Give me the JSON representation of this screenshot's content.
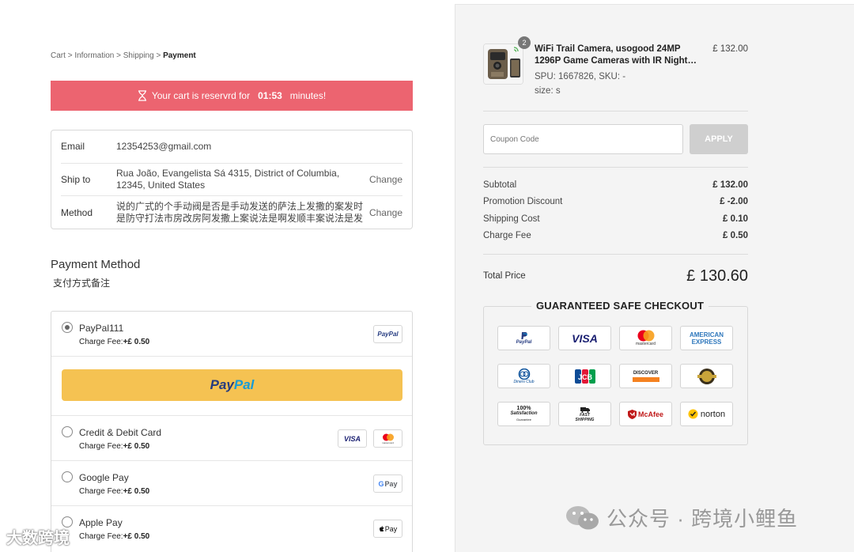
{
  "breadcrumb": {
    "items": [
      "Cart",
      "Information",
      "Shipping"
    ],
    "current": "Payment",
    "sep": ">"
  },
  "timer": {
    "prefix": "Your cart is reservrd for",
    "time": "01:53",
    "suffix": "minutes!"
  },
  "info": {
    "email_label": "Email",
    "email": "12354253@gmail.com",
    "ship_label": "Ship to",
    "ship": "Rua João, Evangelista Sá 4315, District of Columbia, 12345, United States",
    "method_label": "Method",
    "method": "说的广式的个手动阀是否是手动发送的萨法上发撒的案发时是防守打法市房改房阿发撒上案说法是啊发顺丰案说法是发啊说的",
    "change": "Change"
  },
  "payment": {
    "title": "Payment Method",
    "note": "支付方式备注",
    "options": [
      {
        "name": "PayPal111",
        "fee_label": "Charge Fee:",
        "fee": "+£ 0.50",
        "selected": true
      },
      {
        "name": "Credit & Debit Card",
        "fee_label": "Charge Fee:",
        "fee": "+£ 0.50",
        "selected": false
      },
      {
        "name": "Google Pay",
        "fee_label": "Charge Fee:",
        "fee": "+£ 0.50",
        "selected": false
      },
      {
        "name": "Apple Pay",
        "fee_label": "Charge Fee:",
        "fee": "+£ 0.50",
        "selected": false
      }
    ],
    "paypal_button": {
      "pay": "Pay",
      "pal": "Pal"
    },
    "logos": {
      "paypal": "PayPal",
      "visa": "VISA",
      "mastercard": "mastercard",
      "gpay": "Pay",
      "applepay": "Pay"
    }
  },
  "product": {
    "qty": "2",
    "title": "WiFi Trail Camera, usogood 24MP 1296P Game Cameras with IR Night…",
    "price": "£ 132.00",
    "sku": "SPU: 1667826, SKU: -",
    "size": "size: s"
  },
  "coupon": {
    "placeholder": "Coupon Code",
    "apply": "APPLY"
  },
  "summary": {
    "rows": [
      {
        "label": "Subtotal",
        "value": "£ 132.00"
      },
      {
        "label": "Promotion Discount",
        "value": "£ -2.00"
      },
      {
        "label": "Shipping Cost",
        "value": "£ 0.10"
      },
      {
        "label": "Charge Fee",
        "value": "£ 0.50"
      }
    ],
    "total_label": "Total Price",
    "total": "£ 130.60"
  },
  "checkout": {
    "title": "GUARANTEED SAFE CHECKOUT",
    "badges": {
      "paypal": "PayPal",
      "visa": "VISA",
      "mastercard": "mastercard",
      "amex1": "AMERICAN",
      "amex2": "EXPRESS",
      "diners": "Diners Club",
      "jcb": "JCB",
      "discover": "DISCOVER",
      "satisfaction1": "100%",
      "satisfaction2": "Satisfaction",
      "satisfaction3": "Guarantee",
      "fast1": "FAST",
      "fast2": "SHIPPING",
      "mcafee": "McAfee",
      "norton": "norton"
    }
  },
  "watermark": {
    "right": "公众号 · 跨境小鲤鱼",
    "left": "大数跨境"
  },
  "colors": {
    "timer_bg": "#ec6470",
    "paypal_btn": "#f5c252",
    "apply_bg": "#cfcfcf",
    "right_bg": "#f4f4f4"
  }
}
